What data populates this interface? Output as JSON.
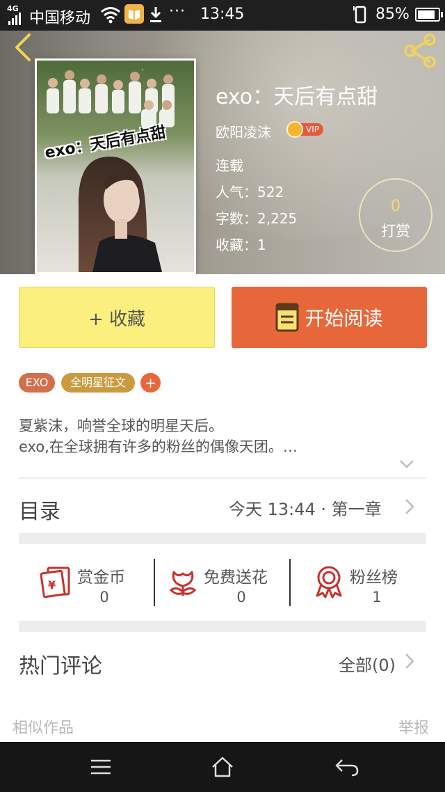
{
  "status_bar": {
    "network": "4G",
    "carrier": "中国移动",
    "time": "13:45",
    "battery_text": "85%",
    "battery_level": 0.85
  },
  "header": {
    "cover_title": "exo：天后有点甜",
    "title": "exo：天后有点甜",
    "author": "欧阳凌沫",
    "vip_label": "VIP",
    "status": "连载",
    "popularity": "人气：522",
    "word_count": "字数：2,225",
    "favorites": "收藏：1",
    "reward_count": "0",
    "reward_label": "打赏"
  },
  "actions": {
    "favorite_label": "+ 收藏",
    "read_label": "开始阅读"
  },
  "tags": [
    "EXO",
    "全明星征文",
    "+"
  ],
  "description": {
    "line1": "夏紫沫，响誉全球的明星天后。",
    "line2": "exo,在全球拥有许多的粉丝的偶像天团。…"
  },
  "catalog": {
    "title": "目录",
    "latest": "今天 13:44 · 第一章"
  },
  "stats": [
    {
      "label": "赏金币",
      "value": "0",
      "icon": "red-envelope-icon"
    },
    {
      "label": "免费送花",
      "value": "0",
      "icon": "flower-icon"
    },
    {
      "label": "粉丝榜",
      "value": "1",
      "icon": "rosette-icon"
    }
  ],
  "comments": {
    "title": "热门评论",
    "all": "全部(0)"
  },
  "footer": {
    "similar": "相似作品",
    "report": "举报"
  },
  "colors": {
    "accent_orange": "#e8673a",
    "favorite_yellow": "#fbf07d",
    "icon_red": "#c9302c"
  }
}
